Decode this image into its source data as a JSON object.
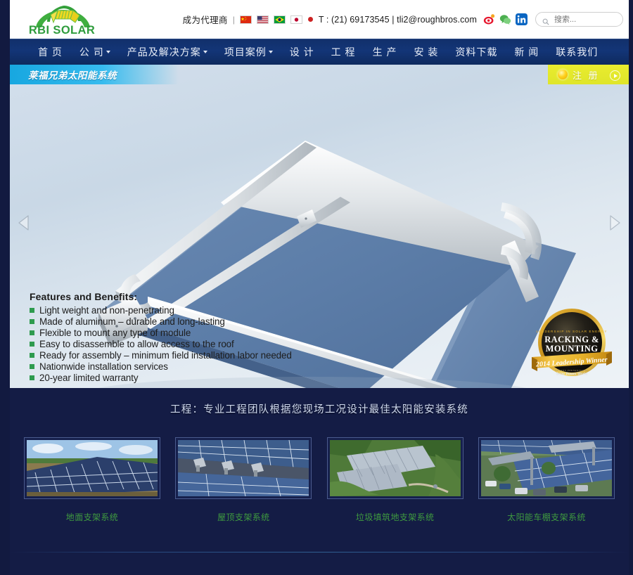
{
  "header": {
    "logo_text": "RBI SOLAR",
    "agent_link": "成为代理商",
    "separator": "|",
    "flags": [
      {
        "name": "china-flag",
        "label": "中国"
      },
      {
        "name": "usa-flag",
        "label": "United States"
      },
      {
        "name": "brazil-flag",
        "label": "Brasil"
      },
      {
        "name": "japan-flag",
        "label": "日本"
      }
    ],
    "contact": "T : (21) 69173545 | tli2@roughbros.com",
    "phone": "T : (21) 69173545",
    "email": "tli2@roughbros.com",
    "social": [
      {
        "name": "weibo-icon",
        "label": "Weibo"
      },
      {
        "name": "wechat-icon",
        "label": "WeChat"
      },
      {
        "name": "linkedin-icon",
        "label": "LinkedIn"
      }
    ],
    "search_placeholder": "搜索...",
    "search_value": ""
  },
  "nav": {
    "items": [
      {
        "label": "首 页",
        "has_dropdown": false
      },
      {
        "label": "公 司",
        "has_dropdown": true
      },
      {
        "label": "产品及解决方案",
        "has_dropdown": true
      },
      {
        "label": "项目案例",
        "has_dropdown": true
      },
      {
        "label": "设 计",
        "has_dropdown": false
      },
      {
        "label": "工 程",
        "has_dropdown": false
      },
      {
        "label": "生 产",
        "has_dropdown": false
      },
      {
        "label": "安 装",
        "has_dropdown": false
      },
      {
        "label": "资料下载",
        "has_dropdown": false
      },
      {
        "label": "新 闻",
        "has_dropdown": false
      },
      {
        "label": "联系我们",
        "has_dropdown": false
      }
    ]
  },
  "hero": {
    "title": "莱福兄弟太阳能系统",
    "register_label": "注 册",
    "prev_label": "上一张",
    "next_label": "下一张",
    "features": {
      "heading": "Features and Benefits:",
      "items": [
        "Light weight and non-penetrating",
        "Made of aluminum – durable and long-lasting",
        "Flexible to mount any type of module",
        "Easy to disassemble to allow access to the roof",
        "Ready for assembly – minimum field installation labor needed",
        "Nationwide installation services",
        "20-year limited warranty"
      ]
    },
    "badge": {
      "top_line": "LEADERSHIP IN SOLAR ENERGY",
      "title_line1": "RACKING &",
      "title_line2": "MOUNTING",
      "ribbon": "2014 Leadership Winner",
      "sponsor_pre": "AWARDS PRESENTED BY",
      "sponsor": "Solar Power World"
    }
  },
  "lower": {
    "section_heading": "工程：专业工程团队根据您现场工况设计最佳太阳能安装系统",
    "products": [
      {
        "caption": "地面支架系统",
        "image": "ground-mount-solar-array"
      },
      {
        "caption": "屋顶支架系统",
        "image": "rooftop-ballasted-array"
      },
      {
        "caption": "垃圾填筑地支架系统",
        "image": "landfill-solar-array-aerial"
      },
      {
        "caption": "太阳能车棚支架系统",
        "image": "solar-carport-array"
      }
    ]
  },
  "colors": {
    "nav_blue": "#133577",
    "dark_navy": "#141c45",
    "brand_green": "#3f9b3f",
    "logo_green": "#2e9b3f",
    "accent_cyan": "#17a7e0",
    "register_yellow": "#e4ea2c",
    "bullet_green": "#2e9b4e"
  }
}
